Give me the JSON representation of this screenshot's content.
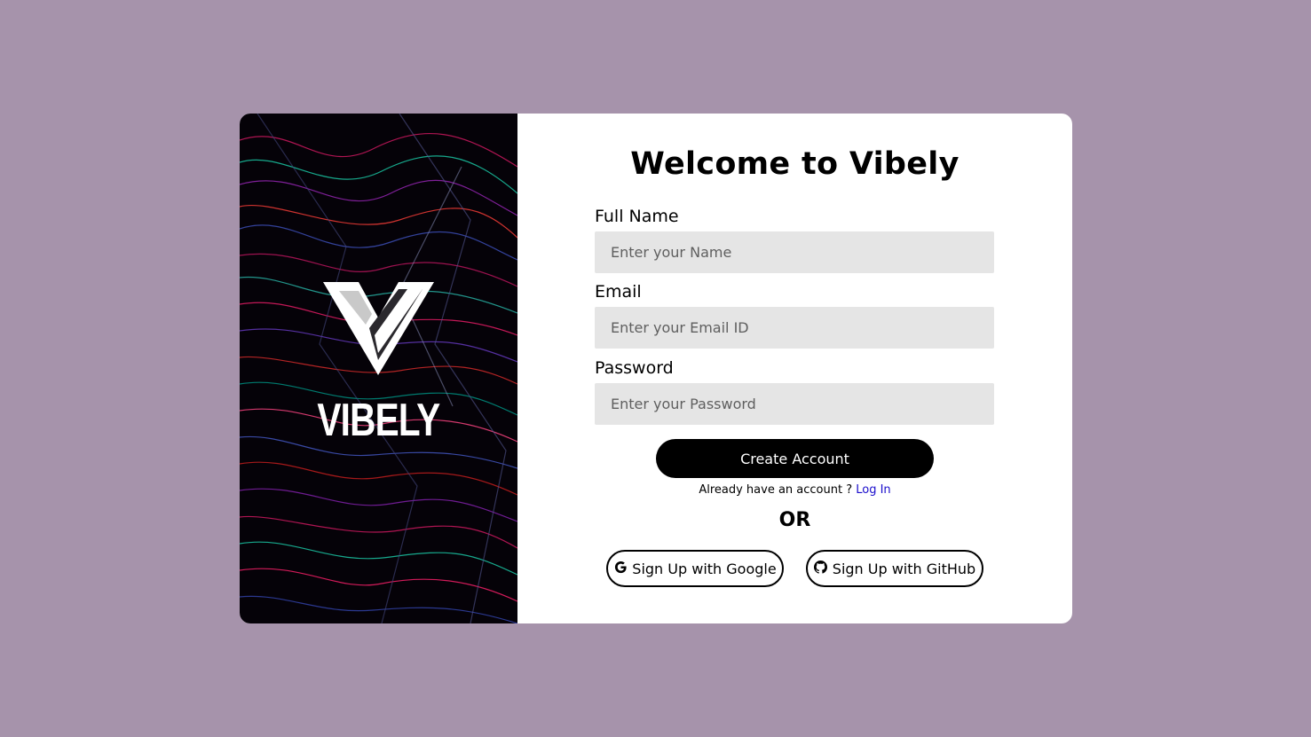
{
  "brand": {
    "name": "VIBELY"
  },
  "form": {
    "title": "Welcome to Vibely",
    "fields": [
      {
        "label": "Full Name",
        "placeholder": "Enter your Name",
        "value": ""
      },
      {
        "label": "Email",
        "placeholder": "Enter your Email ID",
        "value": ""
      },
      {
        "label": "Password",
        "placeholder": "Enter your Password",
        "value": ""
      }
    ],
    "submit_label": "Create Account",
    "login_prompt": "Already have an account ?",
    "login_link": "Log In",
    "divider": "OR",
    "google_label": "Sign Up with Google",
    "github_label": "Sign Up with GitHub"
  },
  "colors": {
    "page_background": "#a693ab",
    "card_background": "#ffffff",
    "art_background": "#050208",
    "input_background": "#e5e5e5",
    "primary_button": "#000000",
    "link": "#1a0dcc"
  },
  "icons": {
    "logo": "vibely-v-logo-icon",
    "google": "google-g-icon",
    "github": "github-octocat-icon"
  }
}
